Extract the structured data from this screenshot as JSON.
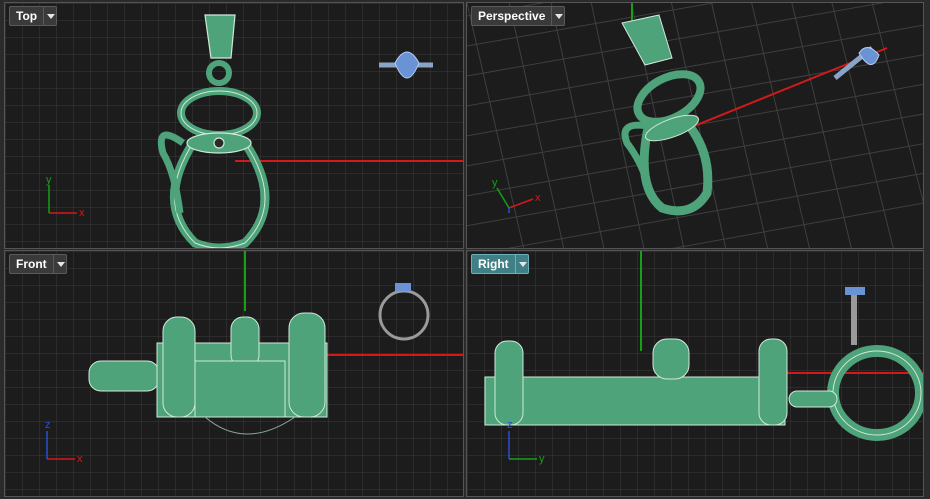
{
  "viewports": {
    "top": {
      "label": "Top",
      "active": false
    },
    "perspective": {
      "label": "Perspective",
      "active": false
    },
    "front": {
      "label": "Front",
      "active": false
    },
    "right": {
      "label": "Right",
      "active": true
    }
  },
  "axes": {
    "x": "x",
    "y": "y",
    "z": "z"
  },
  "colors": {
    "viewport_bg": "#1c1c1c",
    "grid": "#3a3a3a",
    "grid_major": "#5a5a5a",
    "x_axis": "#d21a1a",
    "y_axis": "#15a015",
    "z_axis": "#2a4fd0",
    "model": "#4ea37a",
    "model_edge": "#cfe9d8",
    "ring": "#6a93d6",
    "active_label": "#3f7f86"
  }
}
